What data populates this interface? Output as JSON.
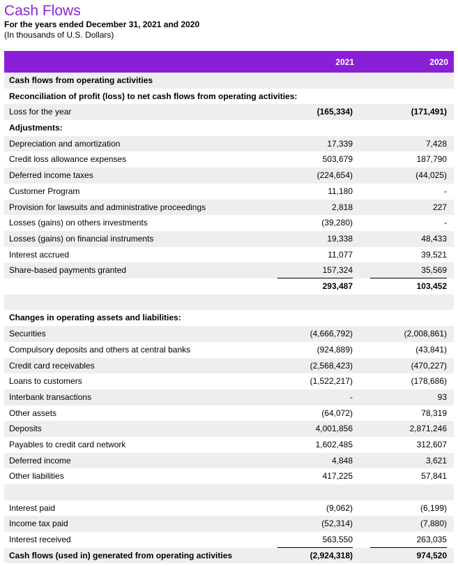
{
  "header": {
    "title": "Cash Flows",
    "subtitle": "For the years ended December 31, 2021 and 2020",
    "units": "(In thousands of U.S. Dollars)",
    "col_2021": "2021",
    "col_2020": "2020"
  },
  "section1": [
    {
      "label": "Cash flows from operating activities",
      "v2021": "",
      "v2020": "",
      "bold": true,
      "shade": true
    },
    {
      "label": "Reconciliation of profit (loss) to net cash flows from operating activities:",
      "v2021": "",
      "v2020": "",
      "bold": true,
      "shade": false
    },
    {
      "label": "Loss for the year",
      "v2021": "(165,334)",
      "v2020": "(171,491)",
      "bold": false,
      "boldValues": true,
      "shade": true
    },
    {
      "label": "Adjustments:",
      "v2021": "",
      "v2020": "",
      "bold": true,
      "shade": false
    },
    {
      "label": "Depreciation and amortization",
      "v2021": "17,339",
      "v2020": "7,428",
      "bold": false,
      "shade": true
    },
    {
      "label": "Credit loss allowance expenses",
      "v2021": "503,679",
      "v2020": "187,790",
      "bold": false,
      "shade": false
    },
    {
      "label": "Deferred income taxes",
      "v2021": "(224,654)",
      "v2020": "(44,025)",
      "bold": false,
      "shade": true
    },
    {
      "label": "Customer Program",
      "v2021": "11,180",
      "v2020": "-",
      "bold": false,
      "shade": false
    },
    {
      "label": "Provision for lawsuits and administrative proceedings",
      "v2021": "2,818",
      "v2020": "227",
      "bold": false,
      "shade": true
    },
    {
      "label": "Losses (gains) on others investments",
      "v2021": "(39,280)",
      "v2020": "-",
      "bold": false,
      "shade": false
    },
    {
      "label": "Losses (gains) on financial instruments",
      "v2021": "19,338",
      "v2020": "48,433",
      "bold": false,
      "shade": true
    },
    {
      "label": "Interest accrued",
      "v2021": "11,077",
      "v2020": "39,521",
      "bold": false,
      "shade": false
    },
    {
      "label": "Share-based payments granted",
      "v2021": "157,324",
      "v2020": "35,569",
      "bold": false,
      "shade": true
    },
    {
      "label": "",
      "v2021": "293,487",
      "v2020": "103,452",
      "bold": false,
      "boldValues": true,
      "shade": false
    }
  ],
  "section2": [
    {
      "label": "",
      "v2021": "",
      "v2020": "",
      "bold": false,
      "shade": true
    },
    {
      "label": "Changes in operating assets and liabilities:",
      "v2021": "",
      "v2020": "",
      "bold": true,
      "shade": false
    },
    {
      "label": "Securities",
      "v2021": "(4,666,792)",
      "v2020": "(2,008,861)",
      "bold": false,
      "shade": true
    },
    {
      "label": "Compulsory deposits and others at central banks",
      "v2021": "(924,889)",
      "v2020": "(43,841)",
      "bold": false,
      "shade": false
    },
    {
      "label": "Credit card receivables",
      "v2021": "(2,568,423)",
      "v2020": "(470,227)",
      "bold": false,
      "shade": true
    },
    {
      "label": "Loans to customers",
      "v2021": "(1,522,217)",
      "v2020": "(178,686)",
      "bold": false,
      "shade": false
    },
    {
      "label": "Interbank transactions",
      "v2021": "-",
      "v2020": "93",
      "bold": false,
      "shade": true
    },
    {
      "label": "Other assets",
      "v2021": "(64,072)",
      "v2020": "78,319",
      "bold": false,
      "shade": false
    },
    {
      "label": "Deposits",
      "v2021": "4,001,856",
      "v2020": "2,871,246",
      "bold": false,
      "shade": true
    },
    {
      "label": "Payables to credit card network",
      "v2021": "1,602,485",
      "v2020": "312,607",
      "bold": false,
      "shade": false
    },
    {
      "label": "Deferred income",
      "v2021": "4,848",
      "v2020": "3,621",
      "bold": false,
      "shade": true
    },
    {
      "label": "Other liabilities",
      "v2021": "417,225",
      "v2020": "57,841",
      "bold": false,
      "shade": false
    },
    {
      "label": "",
      "v2021": "",
      "v2020": "",
      "bold": false,
      "shade": true
    },
    {
      "label": "Interest paid",
      "v2021": "(9,062)",
      "v2020": "(6,199)",
      "bold": false,
      "shade": false
    },
    {
      "label": "Income tax paid",
      "v2021": "(52,314)",
      "v2020": "(7,880)",
      "bold": false,
      "shade": true
    },
    {
      "label": "Interest received",
      "v2021": "563,550",
      "v2020": "263,035",
      "bold": false,
      "shade": false
    },
    {
      "label": "Cash flows (used in) generated from operating activities",
      "v2021": "(2,924,318)",
      "v2020": "974,520",
      "bold": true,
      "shade": true
    }
  ]
}
